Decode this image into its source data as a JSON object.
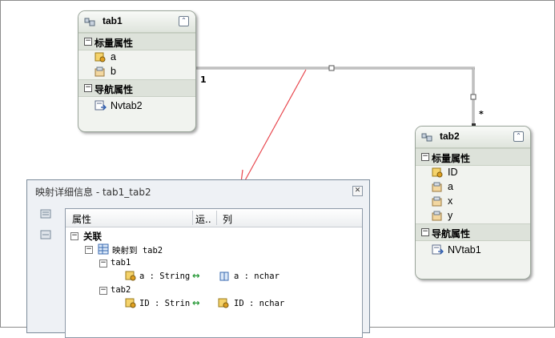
{
  "entities": {
    "tab1": {
      "title": "tab1",
      "scalar_section": "标量属性",
      "nav_section": "导航属性",
      "scalar_props": [
        "a",
        "b"
      ],
      "nav_props": [
        "Nvtab2"
      ]
    },
    "tab2": {
      "title": "tab2",
      "scalar_section": "标量属性",
      "nav_section": "导航属性",
      "scalar_props": [
        "ID",
        "a",
        "x",
        "y"
      ],
      "nav_props": [
        "NVtab1"
      ]
    }
  },
  "association": {
    "end1_multiplicity": "1",
    "end2_multiplicity": "*"
  },
  "mapping_dialog": {
    "title": "映射详细信息 - tab1_tab2",
    "columns": {
      "property": "属性",
      "operator": "运..",
      "column": "列"
    },
    "root_label": "关联",
    "maps_to_label": "映射到 tab2",
    "end1_label": "tab1",
    "end1_property": "a : String",
    "end1_column": "a : nchar",
    "end2_label": "tab2",
    "end2_property": "ID : String",
    "end2_column": "ID : nchar",
    "arrow_glyph": "↔"
  },
  "colors": {
    "annotation_arrow": "#e8484f",
    "key_icon": "#d9a21b",
    "connector": "#9a9a9a"
  }
}
